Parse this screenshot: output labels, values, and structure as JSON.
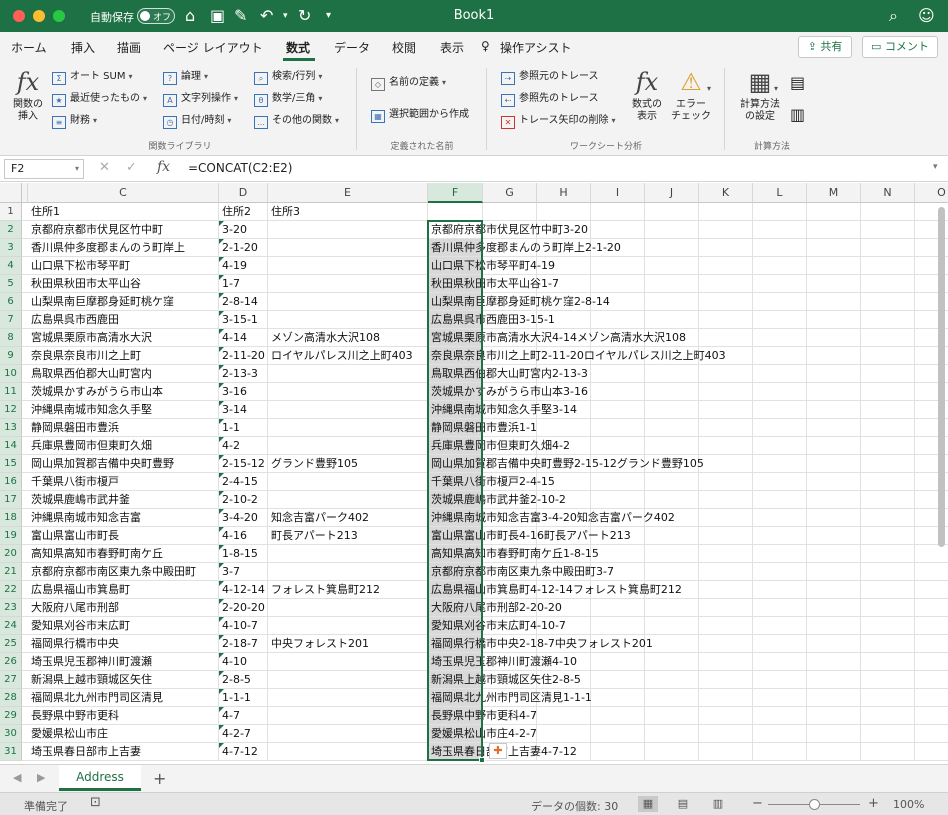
{
  "window": {
    "title": "Book1",
    "autosave_label": "自動保存",
    "autosave_state": "オフ"
  },
  "menu": {
    "tabs": [
      "ホーム",
      "挿入",
      "描画",
      "ページ レイアウト",
      "数式",
      "データ",
      "校閲",
      "表示",
      "操作アシスト"
    ],
    "active_tab": "数式",
    "share_label": "共有",
    "comment_label": "コメント"
  },
  "ribbon": {
    "insert_function": "関数の\n挿入",
    "library": [
      "オート SUM",
      "最近使ったもの",
      "財務",
      "論理",
      "文字列操作",
      "日付/時刻",
      "検索/行列",
      "数学/三角",
      "その他の関数"
    ],
    "library_label": "関数ライブラリ",
    "define_name": "名前の定義",
    "create_from_selection": "選択範囲から作成",
    "names_label": "定義された名前",
    "trace_precedents": "参照元のトレース",
    "trace_dependents": "参照先のトレース",
    "remove_arrows": "トレース矢印の削除",
    "show_formulas": "数式の\n表示",
    "error_check": "エラー\nチェック",
    "audit_label": "ワークシート分析",
    "calc_options": "計算方法\nの設定",
    "calc_label": "計算方法"
  },
  "formula_bar": {
    "name_box": "F2",
    "fx": "fx",
    "formula": "=CONCAT(C2:E2)"
  },
  "grid": {
    "columns": [
      "C",
      "D",
      "E",
      "F",
      "G",
      "H",
      "I",
      "J",
      "K",
      "L",
      "M",
      "N",
      "O"
    ],
    "selected_column": "F",
    "header_row": [
      "住所1",
      "住所2",
      "住所3"
    ],
    "rows": [
      [
        "京都府京都市伏見区竹中町",
        "3-20",
        "",
        "京都府京都市伏見区竹中町3-20"
      ],
      [
        "香川県仲多度郡まんのう町岸上",
        "2-1-20",
        "",
        "香川県仲多度郡まんのう町岸上2-1-20"
      ],
      [
        "山口県下松市琴平町",
        "4-19",
        "",
        "山口県下松市琴平町4-19"
      ],
      [
        "秋田県秋田市太平山谷",
        "1-7",
        "",
        "秋田県秋田市太平山谷1-7"
      ],
      [
        "山梨県南巨摩郡身延町桃ケ窪",
        "2-8-14",
        "",
        "山梨県南巨摩郡身延町桃ケ窪2-8-14"
      ],
      [
        "広島県呉市西鹿田",
        "3-15-1",
        "",
        "広島県呉市西鹿田3-15-1"
      ],
      [
        "宮城県栗原市高清水大沢",
        "4-14",
        "メゾン高清水大沢108",
        "宮城県栗原市高清水大沢4-14メゾン高清水大沢108"
      ],
      [
        "奈良県奈良市川之上町",
        "2-11-20",
        "ロイヤルパレス川之上町403",
        "奈良県奈良市川之上町2-11-20ロイヤルパレス川之上町403"
      ],
      [
        "鳥取県西伯郡大山町宮内",
        "2-13-3",
        "",
        "鳥取県西伯郡大山町宮内2-13-3"
      ],
      [
        "茨城県かすみがうら市山本",
        "3-16",
        "",
        "茨城県かすみがうら市山本3-16"
      ],
      [
        "沖縄県南城市知念久手堅",
        "3-14",
        "",
        "沖縄県南城市知念久手堅3-14"
      ],
      [
        "静岡県磐田市豊浜",
        "1-1",
        "",
        "静岡県磐田市豊浜1-1"
      ],
      [
        "兵庫県豊岡市但東町久畑",
        "4-2",
        "",
        "兵庫県豊岡市但東町久畑4-2"
      ],
      [
        "岡山県加賀郡吉備中央町豊野",
        "2-15-12",
        "グランド豊野105",
        "岡山県加賀郡吉備中央町豊野2-15-12グランド豊野105"
      ],
      [
        "千葉県八街市榎戸",
        "2-4-15",
        "",
        "千葉県八街市榎戸2-4-15"
      ],
      [
        "茨城県鹿嶋市武井釜",
        "2-10-2",
        "",
        "茨城県鹿嶋市武井釜2-10-2"
      ],
      [
        "沖縄県南城市知念吉富",
        "3-4-20",
        "知念吉富パーク402",
        "沖縄県南城市知念吉富3-4-20知念吉富パーク402"
      ],
      [
        "富山県富山市町長",
        "4-16",
        "町長アパート213",
        "富山県富山市町長4-16町長アパート213"
      ],
      [
        "高知県高知市春野町南ケ丘",
        "1-8-15",
        "",
        "高知県高知市春野町南ケ丘1-8-15"
      ],
      [
        "京都府京都市南区東九条中殿田町",
        "3-7",
        "",
        "京都府京都市南区東九条中殿田町3-7"
      ],
      [
        "広島県福山市箕島町",
        "4-12-14",
        "フォレスト箕島町212",
        "広島県福山市箕島町4-12-14フォレスト箕島町212"
      ],
      [
        "大阪府八尾市刑部",
        "2-20-20",
        "",
        "大阪府八尾市刑部2-20-20"
      ],
      [
        "愛知県刈谷市末広町",
        "4-10-7",
        "",
        "愛知県刈谷市末広町4-10-7"
      ],
      [
        "福岡県行橋市中央",
        "2-18-7",
        "中央フォレスト201",
        "福岡県行橋市中央2-18-7中央フォレスト201"
      ],
      [
        "埼玉県児玉郡神川町渡瀬",
        "4-10",
        "",
        "埼玉県児玉郡神川町渡瀬4-10"
      ],
      [
        "新潟県上越市頸城区矢住",
        "2-8-5",
        "",
        "新潟県上越市頸城区矢住2-8-5"
      ],
      [
        "福岡県北九州市門司区清見",
        "1-1-1",
        "",
        "福岡県北九州市門司区清見1-1-1"
      ],
      [
        "長野県中野市更科",
        "4-7",
        "",
        "長野県中野市更科4-7"
      ],
      [
        "愛媛県松山市庄",
        "4-2-7",
        "",
        "愛媛県松山市庄4-2-7"
      ],
      [
        "埼玉県春日部市上吉妻",
        "4-7-12",
        "",
        "埼玉県春日部市上吉妻4-7-12"
      ]
    ]
  },
  "sheet_tabs": {
    "active": "Address",
    "add": "+"
  },
  "status_bar": {
    "ready": "準備完了",
    "count": "データの個数: 30",
    "zoom": "100%",
    "zoom_minus": "−",
    "zoom_plus": "+"
  },
  "colors": {
    "accent": "#1e7145",
    "selection": "#d9d9d9"
  }
}
